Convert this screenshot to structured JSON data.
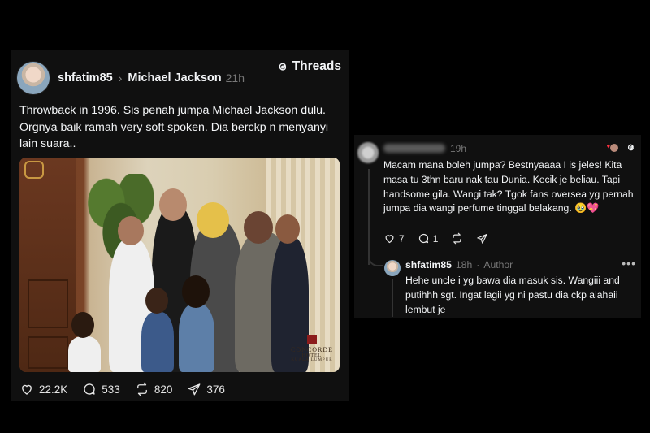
{
  "post": {
    "author": "shfatim85",
    "chevron": "›",
    "target": "Michael Jackson",
    "time": "21h",
    "brand": "Threads",
    "text": "Throwback in 1996. Sis penah jumpa Michael Jackson dulu. Orgnya baik ramah very soft spoken. Dia berckp n menyanyi lain suara..",
    "photo_watermark": {
      "line1": "CONCORDE",
      "line2": "HOTEL",
      "line3": "KUALA LUMPUR"
    },
    "actions": {
      "likes": "22.2K",
      "comments": "533",
      "reposts": "820",
      "shares": "376"
    }
  },
  "reply": {
    "time": "19h",
    "text": "Macam mana boleh jumpa? Bestnyaaaa I is jeles! Kita masa tu 3thn baru nak tau Dunia. Kecik je beliau. Tapi handsome gila. Wangi tak? Tgok fans  oversea yg pernah  jumpa dia wangi perfume tinggal belakang. 🥹💖",
    "likes": "7",
    "comments": "1"
  },
  "nested_reply": {
    "author": "shfatim85",
    "time": "18h",
    "role": "Author",
    "separator": "·",
    "more": "•••",
    "text": "Hehe uncle i yg bawa dia masuk sis. Wangiii and putihhh sgt. Ingat lagii yg ni pastu dia ckp alahaii lembut je"
  },
  "icons": {
    "heart": "heart-icon",
    "comment": "comment-icon",
    "repost": "repost-icon",
    "share": "share-icon",
    "threads": "threads-logo-icon"
  },
  "colors": {
    "background": "#000000",
    "card": "#101010",
    "text": "#f3f5f7",
    "muted": "#777777",
    "like_red": "#ff3040"
  }
}
